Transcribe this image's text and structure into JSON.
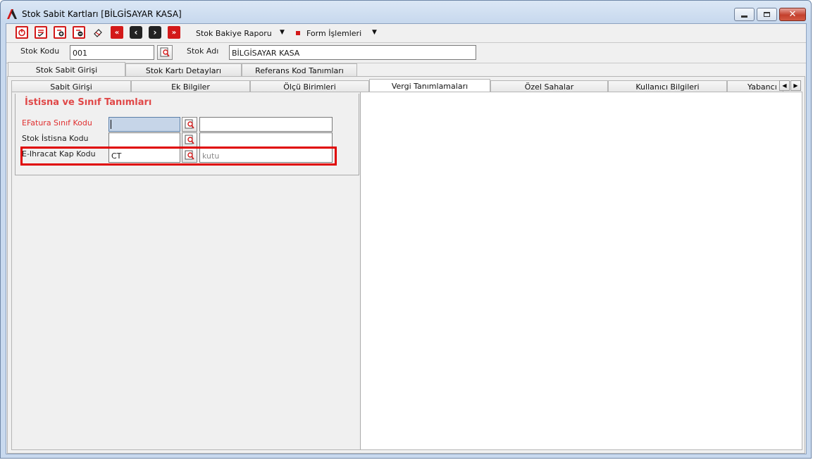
{
  "window": {
    "title": "Stok Sabit Kartları [BİLGİSAYAR KASA]"
  },
  "toolbar": {
    "menus": [
      {
        "label": "Stok Bakiye Raporu"
      },
      {
        "label": "Form İşlemleri"
      }
    ],
    "buttons": [
      "power-icon",
      "checklist-icon",
      "add-record-icon",
      "delete-record-icon",
      "clear-icon",
      "first-record-icon",
      "previous-record-icon",
      "next-record-icon",
      "last-record-icon"
    ]
  },
  "header": {
    "stok_kodu_label": "Stok Kodu",
    "stok_kodu_value": "001",
    "stok_adi_label": "Stok Adı",
    "stok_adi_value": "BİLGİSAYAR KASA"
  },
  "main_tabs": [
    {
      "label": "Stok Sabit Girişi",
      "active": true
    },
    {
      "label": "Stok Kartı Detayları",
      "active": false
    },
    {
      "label": "Referans Kod Tanımları",
      "active": false
    }
  ],
  "sub_tabs": [
    {
      "label": "Sabit Girişi",
      "active": false
    },
    {
      "label": "Ek Bilgiler",
      "active": false
    },
    {
      "label": "Ölçü Birimleri",
      "active": false
    },
    {
      "label": "Vergi Tanımlamaları",
      "active": true
    },
    {
      "label": "Özel Sahalar",
      "active": false
    },
    {
      "label": "Kullanıcı Bilgileri",
      "active": false
    },
    {
      "label": "Yabancı Dil",
      "active": false
    }
  ],
  "group": {
    "title": "İstisna ve Sınıf Tanımları",
    "rows": [
      {
        "label": "EFatura Sınıf Kodu",
        "code": "",
        "description": ""
      },
      {
        "label": "Stok İstisna Kodu",
        "code": "",
        "description": ""
      },
      {
        "label": "E-Ihracat Kap Kodu",
        "code": "CT",
        "description": "kutu"
      }
    ]
  },
  "colors": {
    "accent_red": "#e00000",
    "group_title": "#e04848",
    "efatura_label": "#e03030"
  }
}
